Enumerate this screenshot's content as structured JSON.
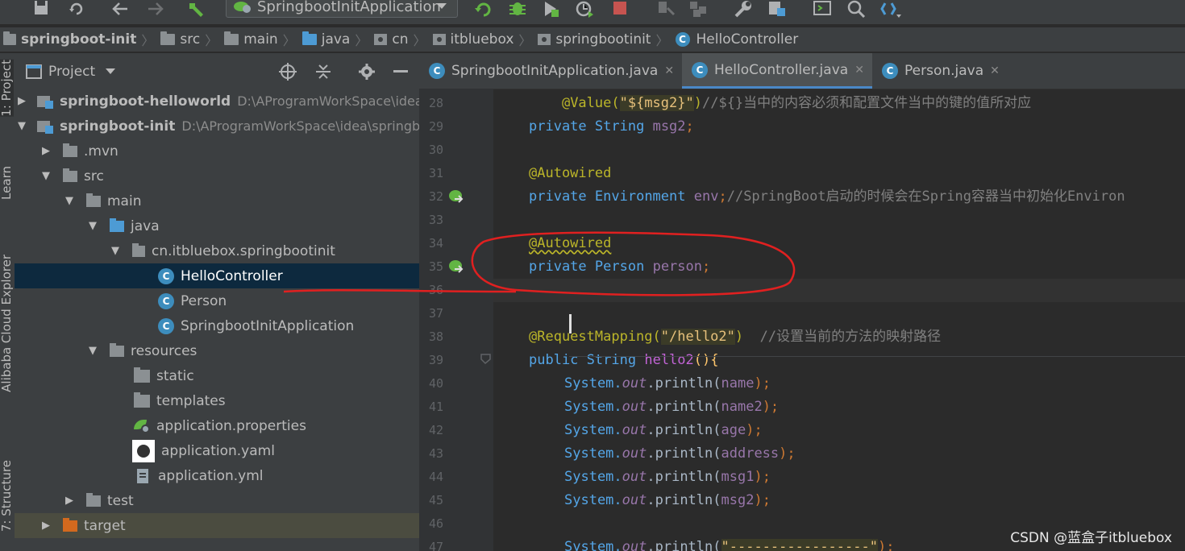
{
  "toolbar": {
    "run_config_label": "SpringbootInitApplication",
    "icons": [
      "save-all-icon",
      "sync-icon",
      "back-icon",
      "forward-icon",
      "build-hammer-icon",
      "rerun-icon",
      "debug-icon",
      "run-coverage-icon",
      "profile-icon",
      "stop-icon",
      "attach-icon",
      "modules-icon",
      "settings-wrench-icon",
      "project-structure-icon",
      "terminal-icon",
      "search-icon",
      "vcs-icon"
    ]
  },
  "breadcrumb": {
    "items": [
      "springboot-init",
      "src",
      "main",
      "java",
      "cn",
      "itbluebox",
      "springbootinit",
      "HelloController"
    ]
  },
  "tool_strip": {
    "tabs": [
      "1: Project",
      "Learn",
      "Alibaba Cloud Explorer",
      "7: Structure"
    ]
  },
  "project_panel": {
    "title": "Project",
    "tree": [
      {
        "label": "springboot-helloworld",
        "path": "D:\\AProgramWorkSpace\\idea\\",
        "bold": true
      },
      {
        "label": "springboot-init",
        "path": "D:\\AProgramWorkSpace\\idea\\springb",
        "bold": true
      },
      {
        "label": ".mvn"
      },
      {
        "label": "src"
      },
      {
        "label": "main"
      },
      {
        "label": "java"
      },
      {
        "label": "cn.itbluebox.springbootinit"
      },
      {
        "label": "HelloController"
      },
      {
        "label": "Person"
      },
      {
        "label": "SpringbootInitApplication"
      },
      {
        "label": "resources"
      },
      {
        "label": "static"
      },
      {
        "label": "templates"
      },
      {
        "label": "application.properties"
      },
      {
        "label": "application.yaml"
      },
      {
        "label": "application.yml"
      },
      {
        "label": "test"
      },
      {
        "label": "target"
      }
    ]
  },
  "editor": {
    "tabs": [
      {
        "label": "SpringbootInitApplication.java"
      },
      {
        "label": "HelloController.java"
      },
      {
        "label": "Person.java"
      }
    ],
    "line_numbers": [
      "28",
      "29",
      "30",
      "31",
      "32",
      "33",
      "34",
      "35",
      "36",
      "37",
      "38",
      "39",
      "40",
      "41",
      "42",
      "43",
      "44",
      "45",
      "46",
      "47"
    ],
    "code": {
      "l28": {
        "ann": "@Value(",
        "str": "\"${msg2}\"",
        "rest": ")",
        "cmt": "//${}当中的内容必须和配置文件当中的键的值所对应"
      },
      "l29": {
        "kw": "private",
        "typ": "String",
        "field": "msg2",
        "end": ";"
      },
      "l31": {
        "ann": "@Autowired"
      },
      "l32": {
        "kw": "private",
        "typ": "Environment",
        "field": "env",
        "end": ";",
        "cmt": "//SpringBoot启动的时候会在Spring容器当中初始化Environ"
      },
      "l34": {
        "ann": "@Autowired"
      },
      "l35": {
        "kw": "private",
        "typ": "Person",
        "field": "person",
        "end": ";"
      },
      "l38": {
        "ann": "@RequestMapping(",
        "str": "\"/hello2\"",
        "rest": ")",
        "cmt": "//设置当前的方法的映射路径"
      },
      "l39": {
        "kw": "public",
        "typ": "String",
        "fn": "hello2",
        "rest": "(){"
      },
      "println_lines": [
        {
          "cls": "System.",
          "static": "out",
          "call": ".println(",
          "arg": "name",
          "end": ");"
        },
        {
          "cls": "System.",
          "static": "out",
          "call": ".println(",
          "arg": "name2",
          "end": ");"
        },
        {
          "cls": "System.",
          "static": "out",
          "call": ".println(",
          "arg": "age",
          "end": ");"
        },
        {
          "cls": "System.",
          "static": "out",
          "call": ".println(",
          "arg": "address",
          "end": ");"
        },
        {
          "cls": "System.",
          "static": "out",
          "call": ".println(",
          "arg": "msg1",
          "end": ");"
        },
        {
          "cls": "System.",
          "static": "out",
          "call": ".println(",
          "arg": "msg2",
          "end": ");"
        }
      ],
      "l47": {
        "cls": "System.",
        "static": "out",
        "call": ".println(",
        "str": "\"-----------------\"",
        "end": ");"
      }
    }
  },
  "watermark": "CSDN @蓝盒子itbluebox",
  "colors": {
    "annotation_circle": "#e02020",
    "selection": "#0d293e",
    "tab_underline": "#4a88c7"
  }
}
